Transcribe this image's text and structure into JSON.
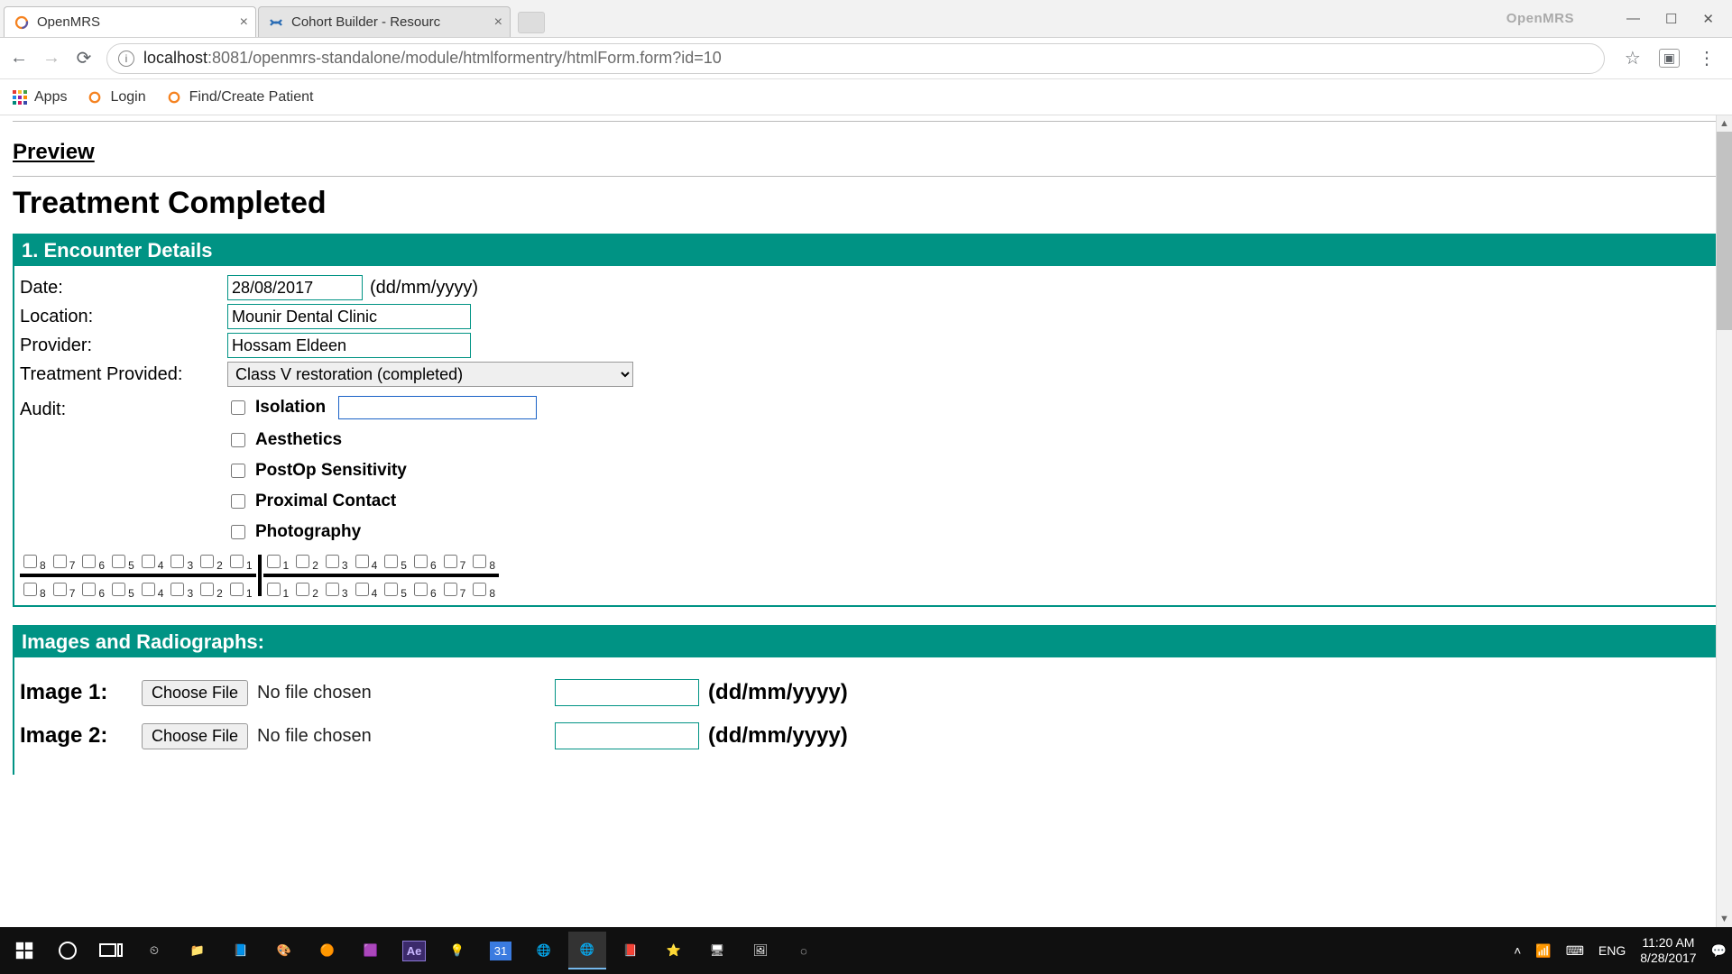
{
  "browser": {
    "tabs": [
      {
        "title": "OpenMRS",
        "active": true
      },
      {
        "title": "Cohort Builder - Resourc",
        "active": false
      }
    ],
    "brand_watermark": "OpenMRS",
    "url_host": "localhost",
    "url_port_path": ":8081/openmrs-standalone/module/htmlformentry/htmlForm.form?id=10"
  },
  "bookmarks": {
    "apps": "Apps",
    "login": "Login",
    "find": "Find/Create Patient"
  },
  "page": {
    "preview": "Preview",
    "title": "Treatment Completed",
    "section_encounter": "1. Encounter Details",
    "labels": {
      "date": "Date:",
      "location": "Location:",
      "provider": "Provider:",
      "treatment": "Treatment Provided:",
      "audit": "Audit:"
    },
    "values": {
      "date": "28/08/2017",
      "date_hint": "(dd/mm/yyyy)",
      "location": "Mounir Dental Clinic",
      "provider": "Hossam Eldeen",
      "treatment": "Class V restoration (completed)"
    },
    "audit_items": [
      "Isolation",
      "Aesthetics",
      "PostOp Sensitivity",
      "Proximal Contact",
      "Photography"
    ],
    "tooth_top_left": [
      "8",
      "7",
      "6",
      "5",
      "4",
      "3",
      "2",
      "1"
    ],
    "tooth_top_right": [
      "1",
      "2",
      "3",
      "4",
      "5",
      "6",
      "7",
      "8"
    ],
    "section_images": "Images and Radiographs:",
    "img1_label": "Image 1:",
    "img2_label": "Image 2:",
    "choose_file": "Choose File",
    "no_file": "No file chosen",
    "img_date_hint": "(dd/mm/yyyy)"
  },
  "taskbar": {
    "lang": "ENG",
    "time": "11:20 AM",
    "date": "8/28/2017"
  }
}
